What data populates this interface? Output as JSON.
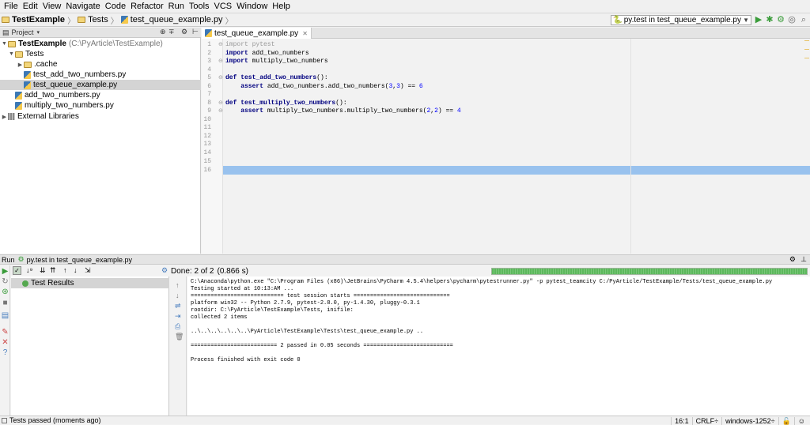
{
  "menubar": {
    "items": [
      {
        "u": "F",
        "rest": "ile"
      },
      {
        "u": "E",
        "rest": "dit"
      },
      {
        "u": "V",
        "rest": "iew"
      },
      {
        "u": "N",
        "rest": "avigate"
      },
      {
        "u": "C",
        "rest": "ode"
      },
      {
        "u": "R",
        "rest": "efactor"
      },
      {
        "u": "R",
        "rest": "un"
      },
      {
        "u": "T",
        "rest": "ools"
      },
      {
        "u": "",
        "rest": "VCS"
      },
      {
        "u": "W",
        "rest": "indow"
      },
      {
        "u": "H",
        "rest": "elp"
      }
    ],
    "labels": [
      "File",
      "Edit",
      "View",
      "Navigate",
      "Code",
      "Refactor",
      "Run",
      "Tools",
      "VCS",
      "Window",
      "Help"
    ]
  },
  "navbar": {
    "project": "TestExample",
    "folder": "Tests",
    "file": "test_queue_example.py"
  },
  "toolbar": {
    "run_config": "py.test in test_queue_example.py"
  },
  "project_panel": {
    "title": "Project",
    "tree": {
      "root_name": "TestExample",
      "root_path": "(C:\\PyArticle\\TestExample)",
      "tests": "Tests",
      "cache": ".cache",
      "file1": "test_add_two_numbers.py",
      "file2": "test_queue_example.py",
      "file3": "add_two_numbers.py",
      "file4": "multiply_two_numbers.py",
      "external": "External Libraries"
    }
  },
  "editor": {
    "tab": "test_queue_example.py",
    "line_numbers": [
      "1",
      "2",
      "3",
      "4",
      "5",
      "6",
      "7",
      "8",
      "9",
      "10",
      "11",
      "12",
      "13",
      "14",
      "15",
      "16"
    ],
    "lines": {
      "l1a": "import",
      "l1b": " pytest",
      "l2a": "import",
      "l2b": " add_two_numbers",
      "l3a": "import",
      "l3b": " multiply_two_numbers",
      "l5a": "def",
      "l5b": " test_add_two_numbers",
      "l5c": "():",
      "l6a": "    assert",
      "l6b": " add_two_numbers.add_two_numbers(",
      "l6c": "3",
      "l6d": ",",
      "l6e": "3",
      "l6f": ") == ",
      "l6g": "6",
      "l8a": "def",
      "l8b": " test_multiply_two_numbers",
      "l8c": "():",
      "l9a": "    assert",
      "l9b": " multiply_two_numbers.multiply_two_numbers(",
      "l9c": "2",
      "l9d": ",",
      "l9e": "2",
      "l9f": ") == ",
      "l9g": "4"
    }
  },
  "run_panel": {
    "header": "Run",
    "config": "py.test in test_queue_example.py",
    "status": "Done: 2 of 2",
    "duration": "(0.866 s)",
    "progress_fraction": 1.0,
    "test_root": "Test Results",
    "console": [
      "C:\\Anaconda\\python.exe \"C:\\Program Files (x86)\\JetBrains\\PyCharm 4.5.4\\helpers\\pycharm\\pytestrunner.py\" -p pytest_teamcity C:/PyArticle/TestExample/Tests/test_queue_example.py",
      "Testing started at 10:13:AM ...",
      "============================ test session starts =============================",
      "platform win32 -- Python 2.7.9, pytest-2.8.0, py-1.4.30, pluggy-0.3.1",
      "rootdir: C:\\PyArticle\\TestExample\\Tests, inifile:",
      "collected 2 items",
      "",
      "..\\..\\..\\..\\..\\..\\PyArticle\\TestExample\\Tests\\test_queue_example.py ..",
      "",
      "========================== 2 passed in 0.05 seconds ===========================",
      "",
      "Process finished with exit code 0"
    ]
  },
  "statusbar": {
    "message": "Tests passed (moments ago)",
    "position": "16:1",
    "line_sep": "CRLF÷",
    "encoding": "windows-1252÷"
  },
  "colors": {
    "accent_pass": "#55a84f",
    "cursor_line": "#99c2ee",
    "keyword": "#000080"
  }
}
